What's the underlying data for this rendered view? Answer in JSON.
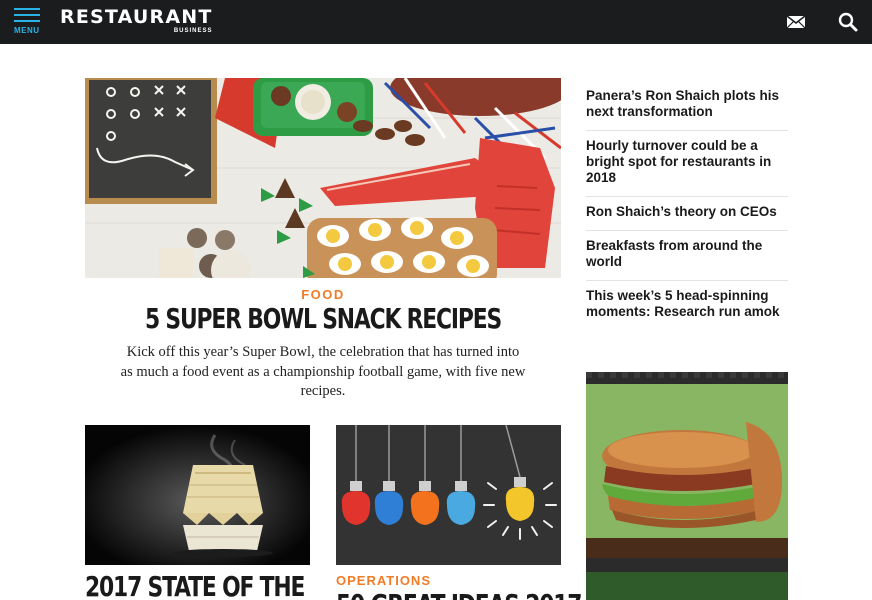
{
  "header": {
    "menu_label": "MENU",
    "brand_name": "RESTAURANT",
    "brand_sub": "BUSINESS",
    "icons": [
      "menu-icon",
      "mail-icon",
      "search-icon"
    ],
    "accent_color": "#2ab3e5",
    "background_color": "#1b1c1e"
  },
  "hero": {
    "image": "super-bowl-snack-spread",
    "kicker": "FOOD",
    "title": "5 SUPER BOWL SNACK RECIPES",
    "dek": "Kick off this year’s Super Bowl, the celebration that has turned into as much a food event as a championship football game, with five new recipes.",
    "kicker_color": "#f07c28"
  },
  "cards": [
    {
      "image": "takeout-container-steam",
      "kicker": "",
      "title": "2017 STATE OF THE"
    },
    {
      "image": "crumpled-paper-lightbulbs",
      "kicker": "OPERATIONS",
      "title": "50 GREAT IDEAS 2017"
    }
  ],
  "rail": {
    "items": [
      {
        "label": "Panera’s Ron Shaich plots his next transformation"
      },
      {
        "label": "Hourly turnover could be a bright spot for restaurants in 2018"
      },
      {
        "label": "Ron Shaich’s theory on CEOs"
      },
      {
        "label": "Breakfasts from around the world"
      },
      {
        "label": "This week’s 5 head-spinning moments: Research run amok"
      }
    ]
  },
  "ad": {
    "image": "sandwich-advertisement"
  }
}
